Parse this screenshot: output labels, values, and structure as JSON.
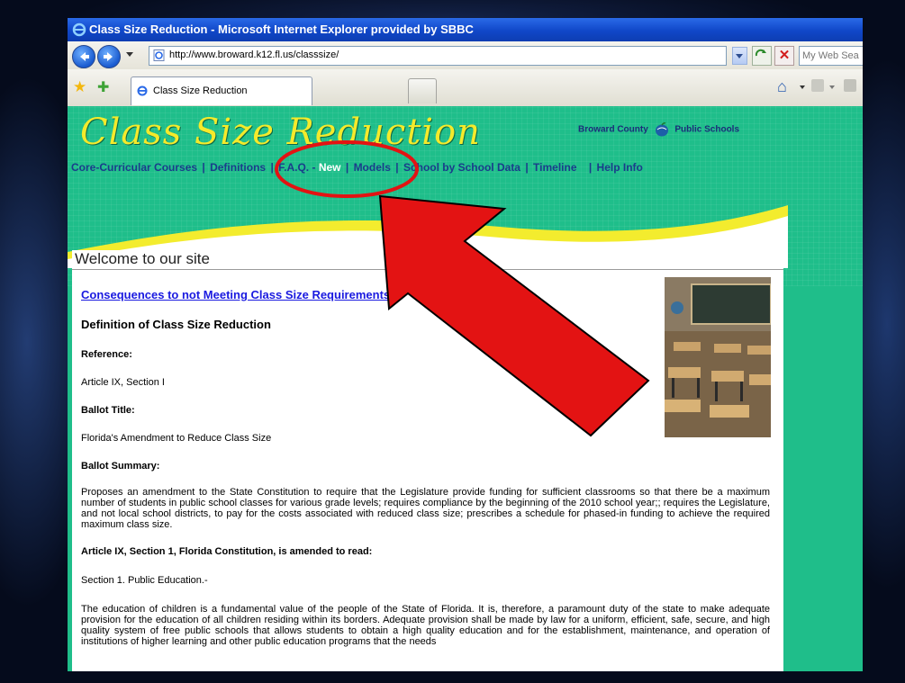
{
  "window": {
    "title": "Class Size Reduction - Microsoft Internet Explorer provided by SBBC"
  },
  "address_bar": {
    "url": "http://www.broward.k12.fl.us/classsize/",
    "search_placeholder": "My Web Sea"
  },
  "tabs": [
    {
      "label": "Class Size Reduction"
    }
  ],
  "site": {
    "title": "Class Size Reduction",
    "logo_left": "Broward County",
    "logo_right": "Public Schools",
    "nav": {
      "core": "Core-Curricular Courses",
      "definitions": "Definitions",
      "faq": "F.A.Q. -",
      "new": "New",
      "models": "Models",
      "school_data": "School by School Data",
      "timeline": "Timeline",
      "help": "Help Info",
      "sep": "|"
    }
  },
  "content": {
    "welcome": "Welcome to our site",
    "consequences_link": "Consequences to not Meeting Class Size Requirements",
    "definition_heading": "Definition of Class Size Reduction",
    "reference_label": "Reference:",
    "reference_text": "Article IX, Section I",
    "ballot_title_label": "Ballot Title:",
    "ballot_title_text": "Florida's Amendment to Reduce Class Size",
    "ballot_summary_label": "Ballot Summary:",
    "ballot_summary_text": "Proposes an amendment to the State Constitution to require that the Legislature provide funding for sufficient classrooms so that there be a maximum number of students in public school classes for various grade levels; requires compliance by the beginning of the 2010 school year;; requires the Legislature, and not local school districts, to pay for the costs associated with reduced class size; prescribes a schedule for phased-in funding to achieve the required maximum class size.",
    "article_heading": "Article IX, Section 1, Florida Constitution, is amended to read:",
    "section_label": "Section 1. Public Education.-",
    "education_text": "The education of children is a fundamental value of the people of the State of Florida. It is, therefore, a paramount duty of the state to make adequate provision for the education of all children residing within its borders. Adequate provision shall be made by law for a uniform, efficient, safe, secure, and high quality system of free public schools that allows students to obtain a high quality education and for the establishment, maintenance, and operation of institutions of higher learning and other public education programs that the needs"
  },
  "colors": {
    "site_green": "#1fbe8a",
    "title_yellow": "#f4ea2b",
    "nav_blue": "#1a3c8b",
    "annotation_red": "#e31313",
    "xp_title_blue": "#1047c8"
  }
}
